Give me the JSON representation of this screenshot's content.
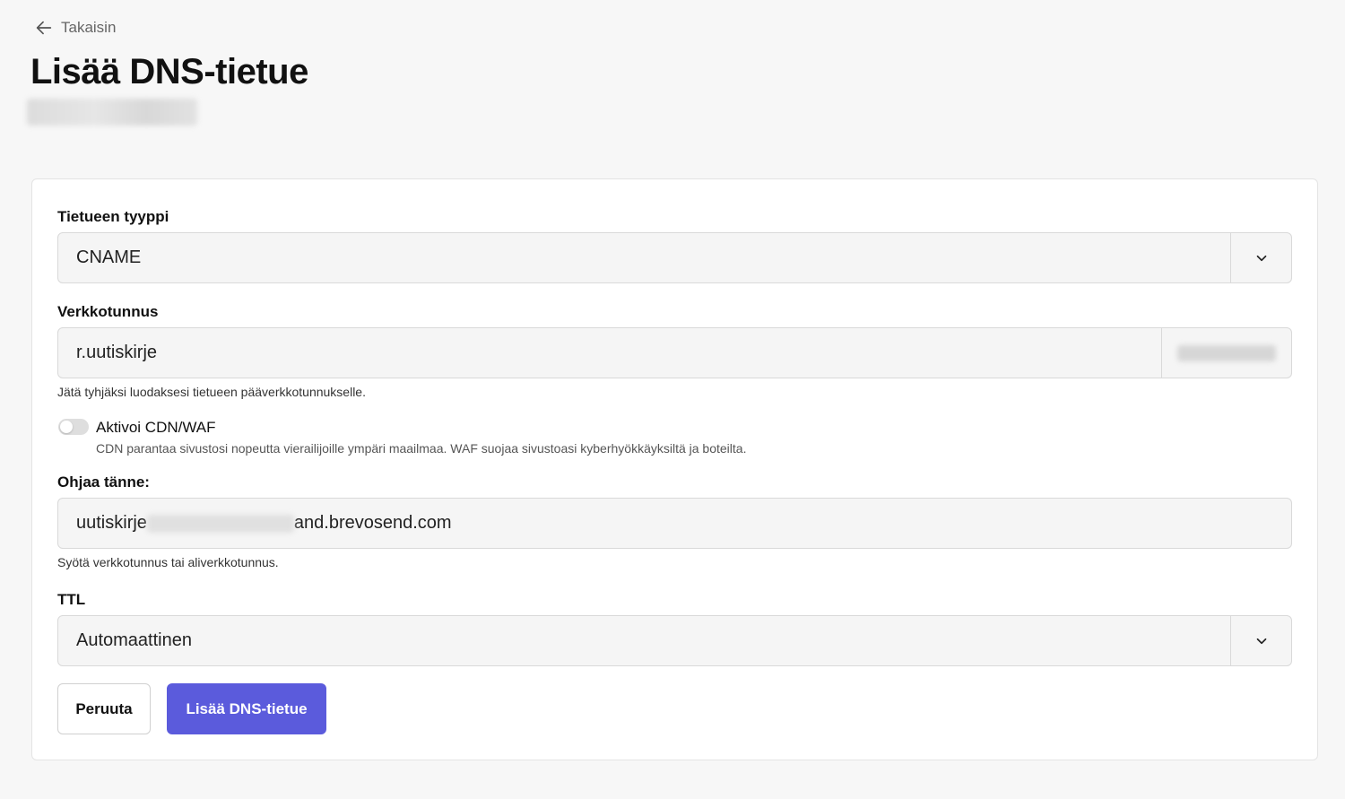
{
  "header": {
    "back_label": "Takaisin",
    "title": "Lisää DNS-tietue"
  },
  "form": {
    "record_type": {
      "label": "Tietueen tyyppi",
      "value": "CNAME"
    },
    "domain": {
      "label": "Verkkotunnus",
      "value": "r.uutiskirje",
      "hint": "Jätä tyhjäksi luodaksesi tietueen pääverkkotunnukselle."
    },
    "cdn": {
      "label": "Aktivoi CDN/WAF",
      "description": "CDN parantaa sivustosi nopeutta vierailijoille ympäri maailmaa. WAF suojaa sivustoasi kyberhyökkäyksiltä ja boteilta.",
      "enabled": false
    },
    "target": {
      "label": "Ohjaa tänne:",
      "value_prefix": "uutiskirje",
      "value_suffix": "and.brevosend.com",
      "hint": "Syötä verkkotunnus tai aliverkkotunnus."
    },
    "ttl": {
      "label": "TTL",
      "value": "Automaattinen"
    }
  },
  "actions": {
    "cancel_label": "Peruuta",
    "submit_label": "Lisää DNS-tietue"
  },
  "colors": {
    "accent": "#5b5bdc",
    "background": "#f7f7f7"
  }
}
